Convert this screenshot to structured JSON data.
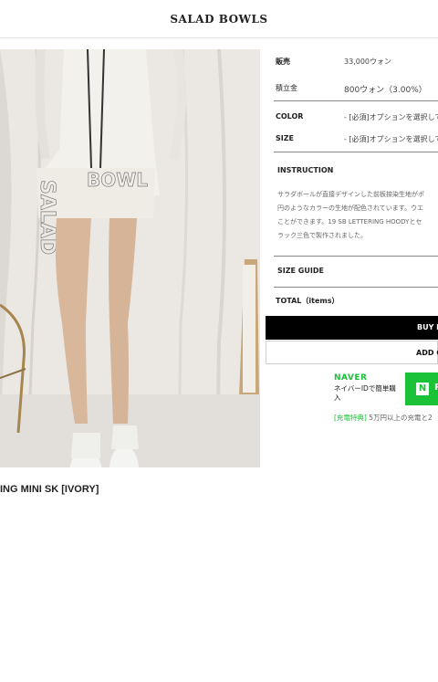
{
  "header": {
    "brand": "SALAD BOWLS"
  },
  "product": {
    "name_partial": "ING MINI SK [IVORY]"
  },
  "info": {
    "price_label": "販売",
    "price_value": "33,000ウォン",
    "points_label": "積立金",
    "points_value": "800ウォン（3.00%）",
    "color_label": "COLOR",
    "color_value": "- [必須]オプションを選択して",
    "size_label": "SIZE",
    "size_value": "- [必須]オプションを選択して",
    "instruction_title": "INSTRUCTION",
    "instruction_lines": [
      "サラダボールが直接デザインした前板捺染生地がポ",
      "円のようなカラーの生地が配色されています。ウエ",
      "ことができます。19 SB LETTERING HOODYとセ",
      "ラック三色で製作されました。"
    ],
    "size_guide": "SIZE GUIDE",
    "total": "TOTAL（items）"
  },
  "buttons": {
    "buy": "BUY N",
    "cart": "ADD C"
  },
  "naver": {
    "logo": "NAVER",
    "desc": "ネイバーIDで簡単購入",
    "pay_n": "N",
    "pay_text": "P",
    "benefit_tag": "[充電特典]",
    "benefit_text": " 5万円以上の充電と2"
  },
  "colors": {
    "naver_green": "#19c237",
    "buy_bg": "#000000"
  }
}
